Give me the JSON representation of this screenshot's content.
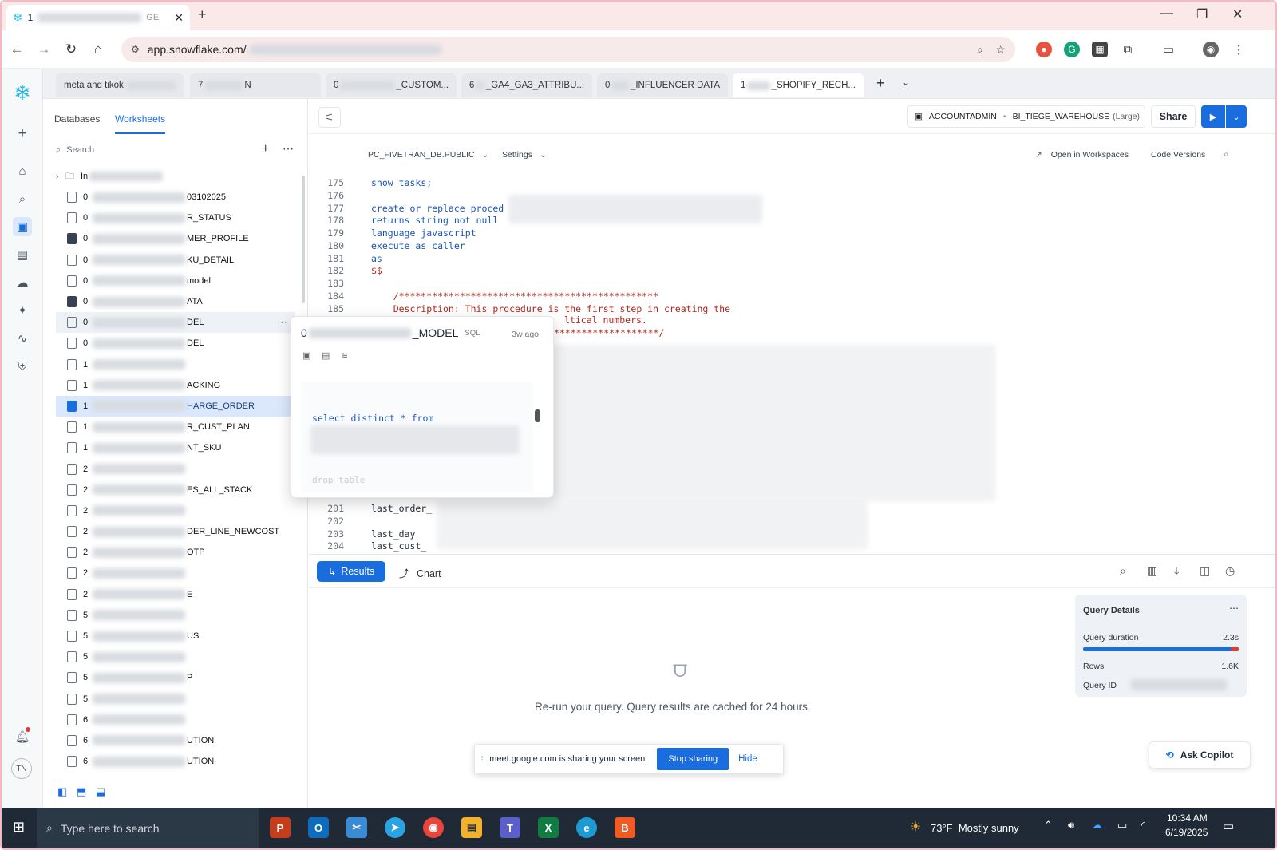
{
  "browser": {
    "tab_title": "1",
    "tab_suffix": "GE",
    "url": "app.snowflake.com/",
    "new_tab": "+"
  },
  "worksheet_tabs": [
    {
      "label": "meta and tikok"
    },
    {
      "label": "7",
      "suffix": "N"
    },
    {
      "label": "0",
      "suffix": "_CUSTOM..."
    },
    {
      "label": "6",
      "suffix": "_GA4_GA3_ATTRIBU..."
    },
    {
      "label": "0",
      "suffix": "_INFLUENCER DATA"
    },
    {
      "label": "1",
      "suffix": "_SHOPIFY_RECH..."
    }
  ],
  "sidebar": {
    "tabs": [
      "Databases",
      "Worksheets"
    ],
    "search_placeholder": "Search",
    "folder_prefix": "In",
    "items": [
      {
        "pre": "0",
        "suf": "03102025",
        "icon": "outline"
      },
      {
        "pre": "0",
        "suf": "R_STATUS",
        "icon": "outline"
      },
      {
        "pre": "0",
        "suf": "MER_PROFILE",
        "icon": "solid"
      },
      {
        "pre": "0",
        "suf": "KU_DETAIL",
        "icon": "outline"
      },
      {
        "pre": "0",
        "suf": "model",
        "icon": "outline"
      },
      {
        "pre": "0",
        "suf": "ATA",
        "icon": "solid"
      },
      {
        "pre": "0",
        "suf": "DEL",
        "icon": "outline",
        "state": "hover"
      },
      {
        "pre": "0",
        "suf": "DEL",
        "icon": "outline"
      },
      {
        "pre": "1",
        "suf": "",
        "icon": "outline"
      },
      {
        "pre": "1",
        "suf": "ACKING",
        "icon": "outline"
      },
      {
        "pre": "1",
        "suf": "HARGE_ORDER",
        "icon": "solid",
        "state": "selected"
      },
      {
        "pre": "1",
        "suf": "R_CUST_PLAN",
        "icon": "outline"
      },
      {
        "pre": "1",
        "suf": "NT_SKU",
        "icon": "outline"
      },
      {
        "pre": "2",
        "suf": "",
        "icon": "outline"
      },
      {
        "pre": "2",
        "suf": "ES_ALL_STACK",
        "icon": "outline"
      },
      {
        "pre": "2",
        "suf": "",
        "icon": "outline"
      },
      {
        "pre": "2",
        "suf": "DER_LINE_NEWCOST",
        "icon": "outline"
      },
      {
        "pre": "2",
        "suf": "OTP",
        "icon": "outline"
      },
      {
        "pre": "2",
        "suf": "",
        "icon": "outline"
      },
      {
        "pre": "2",
        "suf": "E",
        "icon": "outline"
      },
      {
        "pre": "5",
        "suf": "",
        "icon": "outline"
      },
      {
        "pre": "5",
        "suf": "US",
        "icon": "outline"
      },
      {
        "pre": "5",
        "suf": "",
        "icon": "outline"
      },
      {
        "pre": "5",
        "suf": "P",
        "icon": "outline"
      },
      {
        "pre": "5",
        "suf": "",
        "icon": "outline"
      },
      {
        "pre": "6",
        "suf": "",
        "icon": "outline"
      },
      {
        "pre": "6",
        "suf": "UTION",
        "icon": "outline"
      },
      {
        "pre": "6",
        "suf": "UTION",
        "icon": "outline"
      }
    ]
  },
  "rail": {
    "avatar_initials": "TN"
  },
  "editor": {
    "role": "ACCOUNTADMIN",
    "warehouse": "BI_TIEGE_WAREHOUSE",
    "warehouse_size": "(Large)",
    "share": "Share",
    "database": "PC_FIVETRAN_DB.PUBLIC",
    "settings": "Settings",
    "open_in_workspaces": "Open in Workspaces",
    "code_versions": "Code Versions",
    "lines": [
      {
        "n": "175",
        "text": "show tasks;",
        "cls": "kw"
      },
      {
        "n": "176",
        "text": "",
        "cls": ""
      },
      {
        "n": "177",
        "text": "create or replace proced",
        "cls": "kw"
      },
      {
        "n": "178",
        "text": "returns string not null",
        "cls": "kw"
      },
      {
        "n": "179",
        "text": "language javascript",
        "cls": "kw"
      },
      {
        "n": "180",
        "text": "execute as caller",
        "cls": "kw"
      },
      {
        "n": "181",
        "text": "as",
        "cls": "kw"
      },
      {
        "n": "182",
        "text": "$$",
        "cls": "cm"
      },
      {
        "n": "183",
        "text": "",
        "cls": ""
      },
      {
        "n": "184",
        "text": "    /***********************************************",
        "cls": "cm"
      },
      {
        "n": "185",
        "text": "    Description: This procedure is the first step in creating the",
        "cls": "cm"
      }
    ],
    "line_186_tail": "ltical numbers.",
    "line_187_tail": "********************/",
    "lower_lines": [
      {
        "n": "201",
        "text": "last_order_"
      },
      {
        "n": "202",
        "text": ""
      },
      {
        "n": "203",
        "text": "last_day"
      },
      {
        "n": "204",
        "text": "last_cust_"
      }
    ]
  },
  "popup": {
    "name_prefix": "0",
    "name_suffix": "_MODEL",
    "type": "SQL",
    "age": "3w ago",
    "code_line": "select distinct * from",
    "faded_line": "drop table"
  },
  "results": {
    "results_tab": "Results",
    "chart_tab": "Chart",
    "empty_message": "Re-run your query. Query results are cached for 24 hours.",
    "query_details": {
      "title": "Query Details",
      "duration_label": "Query duration",
      "duration_value": "2.3s",
      "rows_label": "Rows",
      "rows_value": "1.6K",
      "id_label": "Query ID"
    },
    "ask_copilot": "Ask Copilot"
  },
  "share_toast": {
    "message": "meet.google.com is sharing your screen.",
    "stop": "Stop sharing",
    "hide": "Hide"
  },
  "taskbar": {
    "search_placeholder": "Type here to search",
    "weather": "73°F  Mostly sunny",
    "time": "10:34 AM",
    "date": "6/19/2025"
  },
  "colors": {
    "accent": "#1a6ddf",
    "chrome_pink": "#fbe8e9",
    "comment": "#b3261e",
    "keyword": "#1a55b8"
  }
}
